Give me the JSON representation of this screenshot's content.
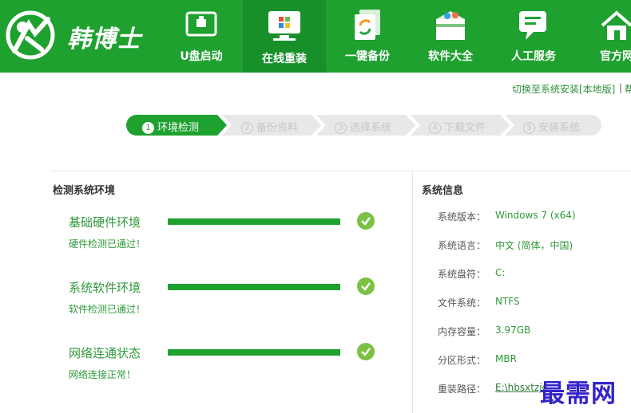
{
  "app": {
    "name": "韩博士"
  },
  "nav": [
    {
      "label": "U盘启动",
      "icon": "usb-drive-icon"
    },
    {
      "label": "在线重装",
      "icon": "windows-monitor-icon",
      "active": true
    },
    {
      "label": "一键备份",
      "icon": "backup-copy-icon"
    },
    {
      "label": "软件大全",
      "icon": "software-box-icon"
    },
    {
      "label": "人工服务",
      "icon": "chat-service-icon"
    },
    {
      "label": "官方网",
      "icon": "home-icon"
    }
  ],
  "header_links": {
    "switch_local": "切换至系统安装[本地版]",
    "separator": "|",
    "more": "帮"
  },
  "steps": [
    {
      "num": "1",
      "label": "环境检测",
      "active": true
    },
    {
      "num": "2",
      "label": "备份资料"
    },
    {
      "num": "3",
      "label": "选择系统"
    },
    {
      "num": "4",
      "label": "下载文件"
    },
    {
      "num": "5",
      "label": "安装系统"
    }
  ],
  "detect": {
    "title": "检测系统环境",
    "items": [
      {
        "name": "基础硬件环境",
        "status": "硬件检测已通过！",
        "progress": 1.0
      },
      {
        "name": "系统软件环境",
        "status": "软件检测已通过！",
        "progress": 1.0
      },
      {
        "name": "网络连通状态",
        "status": "网络连接正常！",
        "progress": 1.0
      }
    ]
  },
  "sysinfo": {
    "title": "系统信息",
    "rows": [
      {
        "label": "系统版本：",
        "value": "Windows 7 (x64)"
      },
      {
        "label": "系统语言：",
        "value": "中文 (简体，中国)"
      },
      {
        "label": "系统盘符：",
        "value": "C:"
      },
      {
        "label": "文件系统：",
        "value": "NTFS"
      },
      {
        "label": "内存容量：",
        "value": "3.97GB"
      },
      {
        "label": "分区形式：",
        "value": "MBR"
      },
      {
        "label": "重装路径：",
        "value": "E:\\hbsxtzjc"
      }
    ]
  },
  "watermark": "最需网",
  "colors": {
    "brand_green": "#1ea12f",
    "active_nav": "#17902a",
    "text_green": "#2e9a3a",
    "check_ok": "#7bc142",
    "watermark": "#3323c8"
  }
}
